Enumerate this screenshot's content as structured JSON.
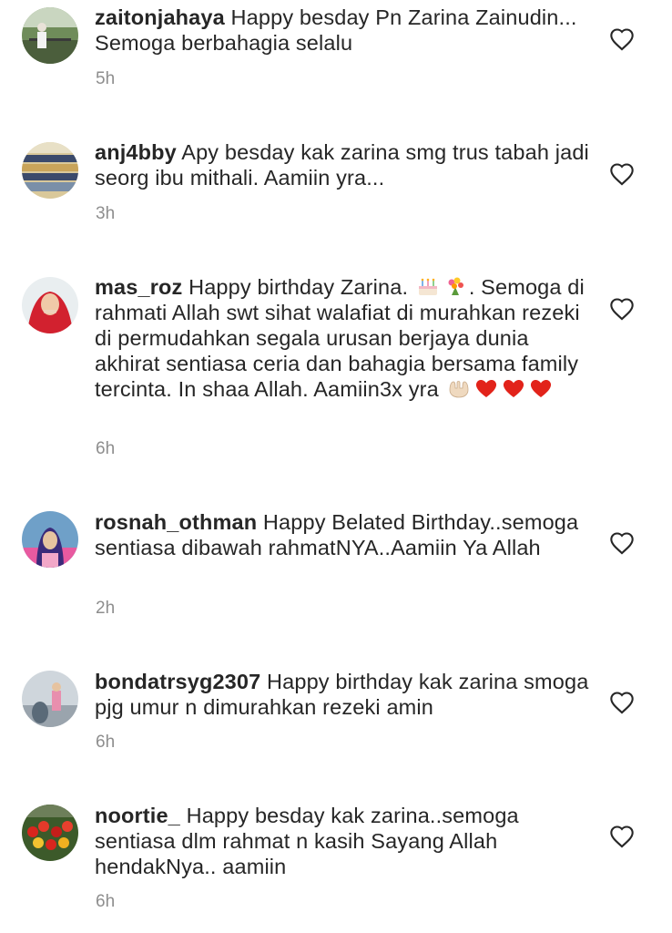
{
  "comments": [
    {
      "username": "zaitonjahaya",
      "text": "Happy besday Pn Zarina Zainudin... Semoga berbahagia selalu",
      "time": "5h",
      "like_icon": "heart-outline-icon"
    },
    {
      "username": "anj4bby",
      "text": "Apy besday kak zarina smg trus tabah jadi seorg ibu mithali. Aamiin yra...",
      "time": "3h",
      "like_icon": "heart-outline-icon"
    },
    {
      "username": "mas_roz",
      "text_part1": "Happy birthday Zarina.",
      "text_part2": ". Semoga di rahmati Allah swt sihat walafiat di murahkan rezeki di permudahkan segala urusan berjaya dunia akhirat sentiasa ceria dan bahagia bersama family tercinta. In shaa Allah. Aamiin3x yra",
      "emojis_1": [
        "birthday-cake-emoji",
        "bouquet-emoji"
      ],
      "emojis_2": [
        "palms-up-emoji",
        "red-heart-emoji",
        "red-heart-emoji",
        "red-heart-emoji"
      ],
      "time": "6h",
      "like_icon": "heart-outline-icon"
    },
    {
      "username": "rosnah_othman",
      "text": "Happy Belated Birthday..semoga sentiasa dibawah rahmatNYA..Aamiin Ya Allah",
      "time": "2h",
      "like_icon": "heart-outline-icon"
    },
    {
      "username": "bondatrsyg2307",
      "text": "Happy birthday kak zarina smoga pjg umur n dimurahkan rezeki amin",
      "time": "6h",
      "like_icon": "heart-outline-icon"
    },
    {
      "username": "noortie_",
      "text": "Happy besday kak zarina..semoga sentiasa dlm rahmat n kasih Sayang Allah hendakNya.. aamiin",
      "time": "6h",
      "like_icon": "heart-outline-icon"
    }
  ],
  "colors": {
    "text": "#262626",
    "secondary": "#8e8e8e",
    "heart_stroke": "#262626"
  }
}
